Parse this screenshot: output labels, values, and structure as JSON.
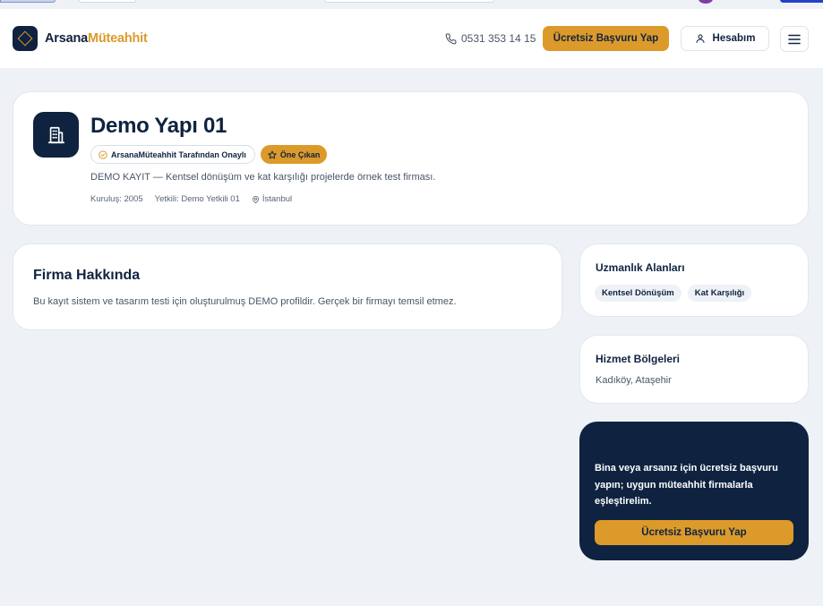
{
  "header": {
    "logo_part1": "Arsana",
    "logo_part2": "Müteahhit",
    "phone": "0531 353 14 15",
    "cta_label": "Ücretsiz Başvuru Yap",
    "account_label": "Hesabım",
    "icons": {
      "logo": "diamond-logo-icon",
      "phone": "phone-icon",
      "account": "user-icon",
      "menu": "hamburger-menu-icon"
    }
  },
  "company": {
    "name": "Demo Yapı 01",
    "badge_verified": "ArsanaMüteahhit Tarafından Onaylı",
    "badge_featured": "Öne Çıkan",
    "description": "DEMO KAYIT — Kentsel dönüşüm ve kat karşılığı projelerde örnek test firması.",
    "founded": "Kuruluş: 2005",
    "contact": "Yetkili: Demo Yetkili 01",
    "location": "İstanbul",
    "icons": {
      "avatar": "building-icon",
      "verified": "check-circle-icon",
      "featured": "star-icon",
      "location": "map-pin-icon"
    }
  },
  "about": {
    "title": "Firma Hakkında",
    "text": "Bu kayıt sistem ve tasarım testi için oluşturulmuş DEMO profildir. Gerçek bir firmayı temsil etmez."
  },
  "expertise": {
    "title": "Uzmanlık Alanları",
    "tags": [
      "Kentsel Dönüşüm",
      "Kat Karşılığı"
    ]
  },
  "regions": {
    "title": "Hizmet Bölgeleri",
    "value": "Kadıköy, Ataşehir"
  },
  "cta_box": {
    "text": "Bina veya arsanız için ücretsiz başvuru yapın; uygun müteahhit firmalarla eşleştirelim.",
    "button": "Ücretsiz Başvuru Yap"
  },
  "colors": {
    "navy": "#0f2340",
    "accent": "#dc9a2a",
    "background": "#eef1f6"
  }
}
